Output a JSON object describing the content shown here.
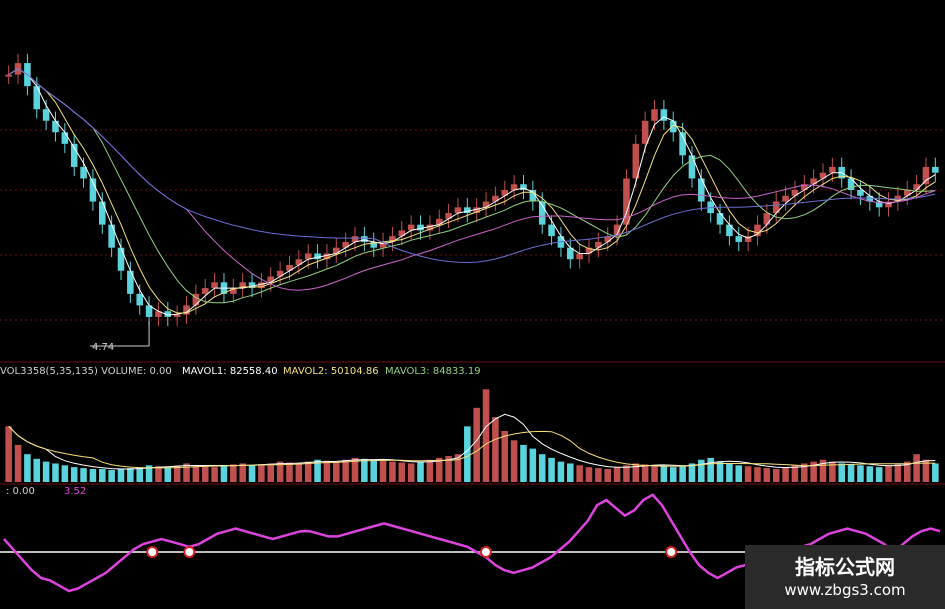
{
  "colors": {
    "background": "#000000",
    "up": "#c0504d",
    "down": "#5ad3dc",
    "ma1": "#ffffff",
    "ma2": "#f5e07a",
    "ma3": "#8fd17f",
    "ma4": "#cc66cc",
    "ma5": "#6a6fd0",
    "gridline": "#6b1010",
    "indicator": "#dd44dd",
    "indicator_base": "#ffffff",
    "marker": "#cc2222"
  },
  "chart_data": [
    {
      "type": "candlestick",
      "title": "",
      "low_annotation": "4.74",
      "close": [
        6.9,
        7.0,
        6.8,
        6.6,
        6.5,
        6.4,
        6.3,
        6.1,
        6.0,
        5.8,
        5.6,
        5.4,
        5.2,
        5.0,
        4.9,
        4.8,
        4.85,
        4.8,
        4.82,
        4.9,
        5.0,
        5.05,
        5.1,
        5.0,
        5.05,
        5.1,
        5.05,
        5.1,
        5.15,
        5.2,
        5.25,
        5.3,
        5.35,
        5.3,
        5.35,
        5.4,
        5.45,
        5.5,
        5.45,
        5.4,
        5.45,
        5.5,
        5.55,
        5.6,
        5.55,
        5.6,
        5.65,
        5.7,
        5.75,
        5.7,
        5.75,
        5.8,
        5.85,
        5.9,
        5.95,
        5.9,
        5.8,
        5.6,
        5.5,
        5.4,
        5.3,
        5.35,
        5.4,
        5.45,
        5.5,
        5.6,
        6.0,
        6.3,
        6.5,
        6.6,
        6.5,
        6.4,
        6.2,
        6.0,
        5.8,
        5.7,
        5.6,
        5.5,
        5.45,
        5.5,
        5.6,
        5.7,
        5.8,
        5.85,
        5.9,
        5.95,
        6.0,
        6.05,
        6.1,
        6.0,
        5.9,
        5.85,
        5.8,
        5.75,
        5.8,
        5.85,
        5.9,
        5.95,
        6.1,
        6.05
      ]
    },
    {
      "type": "bar",
      "title": "",
      "label_volume": "VOL3358(5,35,135)  VOLUME: 0.00",
      "label_mavol1": "MAVOL1: 82558.40",
      "label_mavol2": "MAVOL2: 50104.86",
      "label_mavol3": "MAVOL3: 84833.19",
      "volumes": [
        60,
        40,
        30,
        25,
        22,
        20,
        18,
        16,
        15,
        14,
        14,
        13,
        14,
        15,
        16,
        18,
        17,
        16,
        18,
        20,
        18,
        17,
        16,
        18,
        19,
        20,
        18,
        19,
        20,
        22,
        21,
        20,
        22,
        24,
        23,
        22,
        24,
        26,
        25,
        24,
        23,
        22,
        21,
        20,
        22,
        24,
        26,
        28,
        30,
        60,
        80,
        100,
        70,
        55,
        45,
        40,
        36,
        30,
        26,
        22,
        20,
        18,
        16,
        15,
        14,
        16,
        18,
        20,
        19,
        18,
        17,
        16,
        18,
        20,
        24,
        26,
        22,
        20,
        18,
        17,
        16,
        15,
        14,
        16,
        18,
        20,
        22,
        24,
        22,
        20,
        19,
        18,
        17,
        16,
        18,
        20,
        22,
        30,
        24,
        20
      ]
    },
    {
      "type": "line",
      "title": "",
      "label_base": ": 0.00",
      "label_value": "3.52",
      "values": [
        5,
        1,
        -3,
        -7,
        -10,
        -11,
        -13,
        -15,
        -14,
        -12,
        -10,
        -8,
        -5,
        -2,
        1,
        3,
        4,
        5,
        4,
        3,
        2,
        3,
        5,
        7,
        8,
        9,
        8,
        7,
        6,
        5,
        6,
        7,
        8,
        8,
        7,
        6,
        6,
        7,
        8,
        9,
        10,
        11,
        10,
        9,
        8,
        7,
        6,
        5,
        4,
        3,
        2,
        0,
        -2,
        -5,
        -7,
        -8,
        -7,
        -6,
        -4,
        -2,
        1,
        4,
        8,
        12,
        18,
        20,
        17,
        14,
        16,
        20,
        22,
        18,
        12,
        6,
        0,
        -5,
        -8,
        -10,
        -8,
        -6,
        -5,
        -6,
        -8,
        -5,
        -2,
        0,
        2,
        3,
        5,
        7,
        8,
        9,
        8,
        7,
        5,
        3,
        0,
        3,
        6,
        8,
        9,
        8
      ],
      "markers_at": [
        16,
        20,
        52,
        72
      ]
    }
  ],
  "watermark": {
    "title": "指标公式网",
    "url": "www.zbgs3.com"
  }
}
